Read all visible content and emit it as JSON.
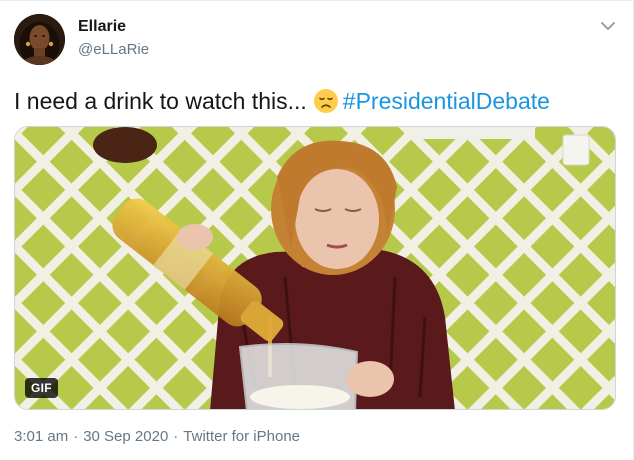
{
  "tweet": {
    "display_name": "Ellarie",
    "handle": "@eLLaRie",
    "text": "I need a drink to watch this...",
    "emoji": "disappointed-face",
    "hashtag": "#PresidentialDebate",
    "media": {
      "badge": "GIF",
      "subject": "woman pouring a drink into a glass pitcher"
    },
    "time": "3:01 am",
    "date": "30 Sep 2020",
    "separator": "·",
    "source": "Twitter for iPhone"
  },
  "colors": {
    "text": "#14171a",
    "secondary": "#657786",
    "link": "#1b95e0",
    "border": "#e6ecf0"
  },
  "icons": {
    "menu": "chevron-down-icon"
  }
}
